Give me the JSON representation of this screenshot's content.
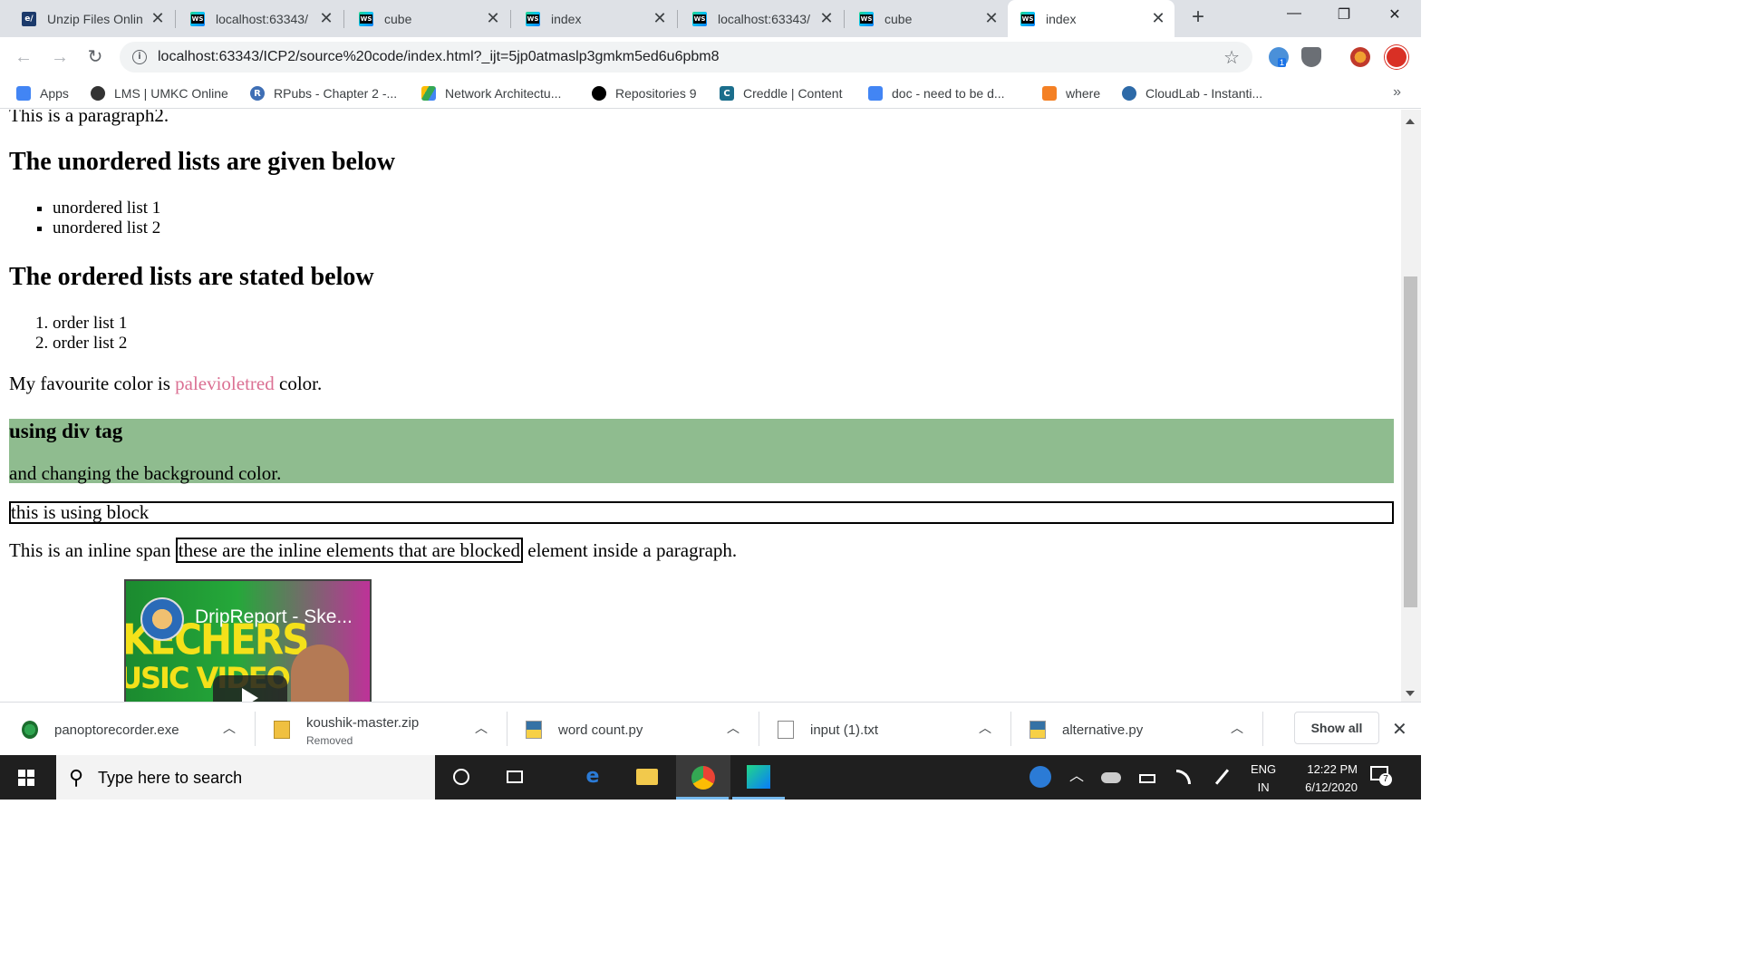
{
  "tabs": [
    {
      "title": "Unzip Files Onlin",
      "icon": "ezyzip-icon",
      "active": false
    },
    {
      "title": "localhost:63343/",
      "icon": "webstorm-icon",
      "active": false
    },
    {
      "title": "cube",
      "icon": "webstorm-icon",
      "active": false
    },
    {
      "title": "index",
      "icon": "webstorm-icon",
      "active": false
    },
    {
      "title": "localhost:63343/",
      "icon": "webstorm-icon",
      "active": false
    },
    {
      "title": "cube",
      "icon": "webstorm-icon",
      "active": false
    },
    {
      "title": "index",
      "icon": "webstorm-icon",
      "active": true
    }
  ],
  "glyphs": {
    "close": "✕",
    "plus": "+",
    "minimize": "—",
    "restore": "❐",
    "back": "←",
    "forward": "→",
    "reload": "↻",
    "info": "i",
    "star": "☆",
    "chevron_up": "︿",
    "chevron_more": "»",
    "magnifier": "⚲"
  },
  "address_bar": {
    "url": "localhost:63343/ICP2/source%20code/index.html?_ijt=5jp0atmaslp3gmkm5ed6u6pbm8"
  },
  "extensions": {
    "badge_count": "1"
  },
  "bookmarks": [
    {
      "label": "Apps",
      "icon": "apps-grid-icon",
      "color": "#4285f4"
    },
    {
      "label": "LMS | UMKC Online",
      "icon": "umkc-icon",
      "color": "#333333"
    },
    {
      "label": "RPubs - Chapter 2 -...",
      "icon": "rpubs-icon",
      "color": "#3f6fb5"
    },
    {
      "label": "Network Architectu...",
      "icon": "google-drive-icon",
      "color": "#34a853"
    },
    {
      "label": "Repositories 9",
      "icon": "github-icon",
      "color": "#000000"
    },
    {
      "label": "Creddle | Content",
      "icon": "creddle-icon",
      "color": "#1b6e8c"
    },
    {
      "label": "doc - need to be d...",
      "icon": "google-docs-icon",
      "color": "#4285f4"
    },
    {
      "label": "where",
      "icon": "stackoverflow-icon",
      "color": "#f48024"
    },
    {
      "label": "CloudLab - Instanti...",
      "icon": "cloudlab-icon",
      "color": "#2d6aa8"
    }
  ],
  "page": {
    "paragraph2": "This is a paragraph2.",
    "unordered_heading": "The unordered lists are given below",
    "unordered_items": [
      "unordered list 1",
      "unordered list 2"
    ],
    "ordered_heading": "The ordered lists are stated below",
    "ordered_items": [
      "order list 1",
      "order list 2"
    ],
    "favourite_prefix": "My favourite color is",
    "favourite_color_word": "palevioletred",
    "favourite_suffix": "color.",
    "favourite_color_value": "#db7093",
    "div_heading": "using div tag",
    "div_text": "and changing the background color.",
    "div_background": "#8fbc8f",
    "block_text": "this is using block",
    "inline_prefix": "This is an inline span",
    "inline_boxed": "these are the inline elements that are blocked",
    "inline_suffix": "element inside a paragraph.",
    "video": {
      "title": "DripReport - Ske...",
      "thumb_text_1": "KECHERS",
      "thumb_text_2": "USIC VIDEO"
    }
  },
  "downloads": [
    {
      "name": "panoptorecorder.exe",
      "status": "",
      "icon": "exe-installer-icon"
    },
    {
      "name": "koushik-master.zip",
      "status": "Removed",
      "icon": "zip-file-icon"
    },
    {
      "name": "word count.py",
      "status": "",
      "icon": "python-file-icon"
    },
    {
      "name": "input (1).txt",
      "status": "",
      "icon": "text-file-icon"
    },
    {
      "name": "alternative.py",
      "status": "",
      "icon": "python-file-icon"
    }
  ],
  "download_shelf": {
    "show_all_label": "Show all"
  },
  "taskbar": {
    "search_placeholder": "Type here to search",
    "language": "ENG",
    "region": "IN",
    "time": "12:22 PM",
    "date": "6/12/2020",
    "notification_count": "7"
  }
}
